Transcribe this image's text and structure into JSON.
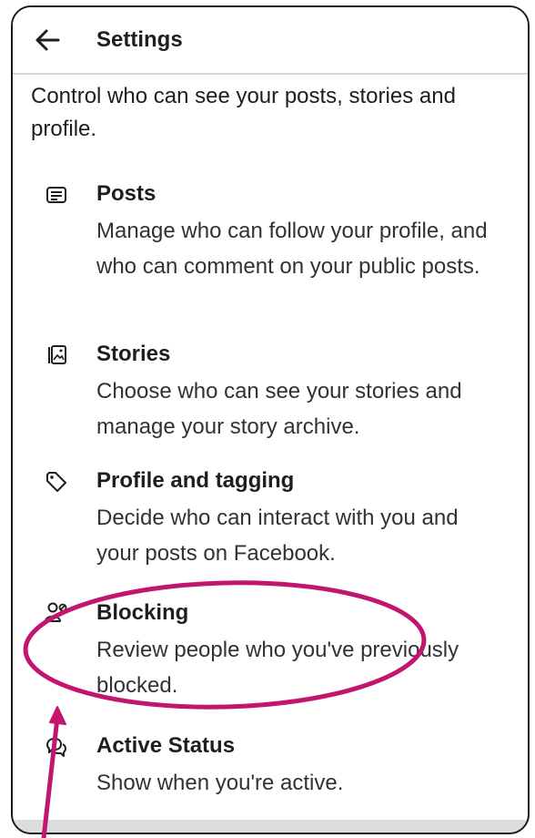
{
  "header": {
    "back_icon": "arrow-left-icon",
    "title": "Settings"
  },
  "intro": "Control who can see your posts, stories and profile.",
  "items": [
    {
      "icon": "posts-icon",
      "title": "Posts",
      "description": "Manage who can follow your profile, and who can comment on your public posts."
    },
    {
      "icon": "stories-icon",
      "title": "Stories",
      "description": "Choose who can see your stories and manage your story archive."
    },
    {
      "icon": "tag-icon",
      "title": "Profile and tagging",
      "description": "Decide who can interact with you and your posts on Facebook."
    },
    {
      "icon": "blocking-icon",
      "title": "Blocking",
      "description": "Review people who you've previously blocked."
    },
    {
      "icon": "chat-bubbles-icon",
      "title": "Active Status",
      "description": "Show when you're active."
    }
  ],
  "colors": {
    "annotation": "#c2166e",
    "text": "#1c1e21",
    "secondary_text": "#303236"
  }
}
